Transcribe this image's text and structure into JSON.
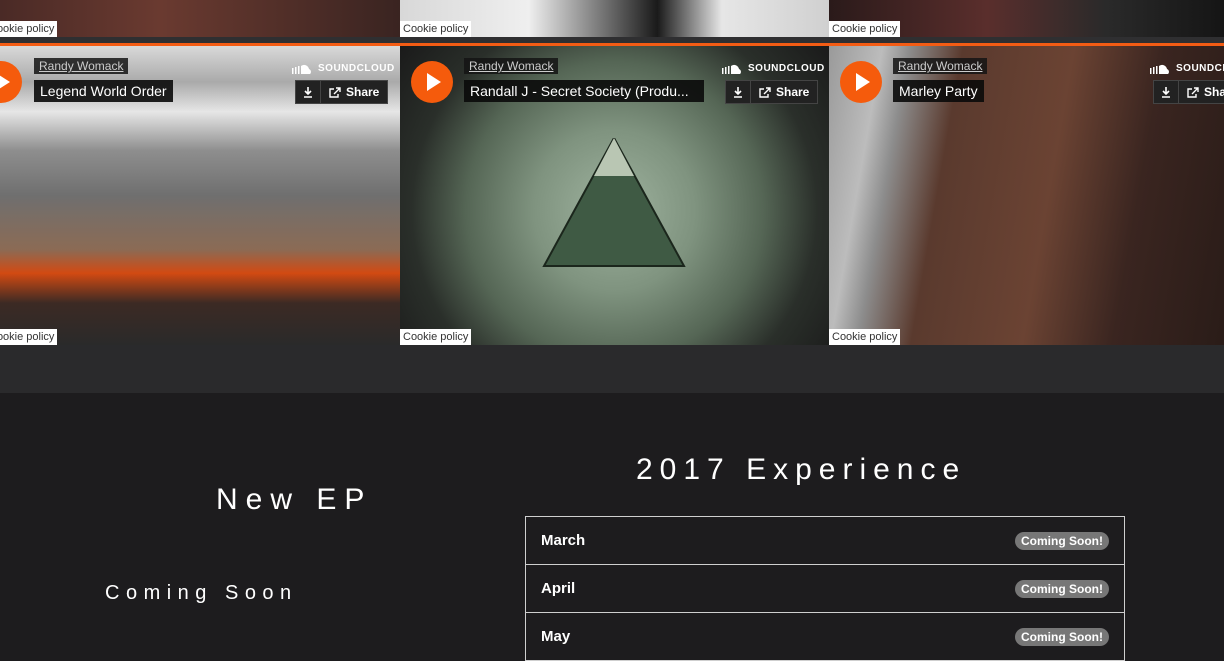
{
  "top_row": {
    "cookie_labels": [
      "Cookie policy",
      "Cookie policy",
      "Cookie policy"
    ]
  },
  "players": [
    {
      "artist": "Randy Womack",
      "track": "Legend World Order",
      "brand": "SOUNDCLOUD",
      "share_label": "Share",
      "cookie_label": "Cookie policy",
      "icons": [
        "play-icon",
        "soundcloud-logo-icon",
        "download-icon",
        "share-icon"
      ]
    },
    {
      "artist": "Randy Womack",
      "track": "Randall J - Secret Society (Produ...",
      "brand": "SOUNDCLOUD",
      "share_label": "Share",
      "cookie_label": "Cookie policy",
      "icons": [
        "play-icon",
        "soundcloud-logo-icon",
        "download-icon",
        "share-icon"
      ]
    },
    {
      "artist": "Randy Womack",
      "track": "Marley Party",
      "brand": "SOUNDCLOUD",
      "share_label": "Share",
      "cookie_label": "Cookie policy",
      "icons": [
        "play-icon",
        "soundcloud-logo-icon",
        "download-icon",
        "share-icon"
      ]
    }
  ],
  "new_ep": {
    "title": "New EP",
    "subtitle": "Coming Soon"
  },
  "experience": {
    "title": "2017 Experience",
    "rows": [
      {
        "month": "March",
        "status": "Coming Soon!"
      },
      {
        "month": "April",
        "status": "Coming Soon!"
      },
      {
        "month": "May",
        "status": "Coming Soon!"
      }
    ]
  },
  "colors": {
    "accent": "#f35c14",
    "page_background": "#1d1c1e",
    "band_background": "#2a2a2c",
    "badge": "#777777"
  }
}
